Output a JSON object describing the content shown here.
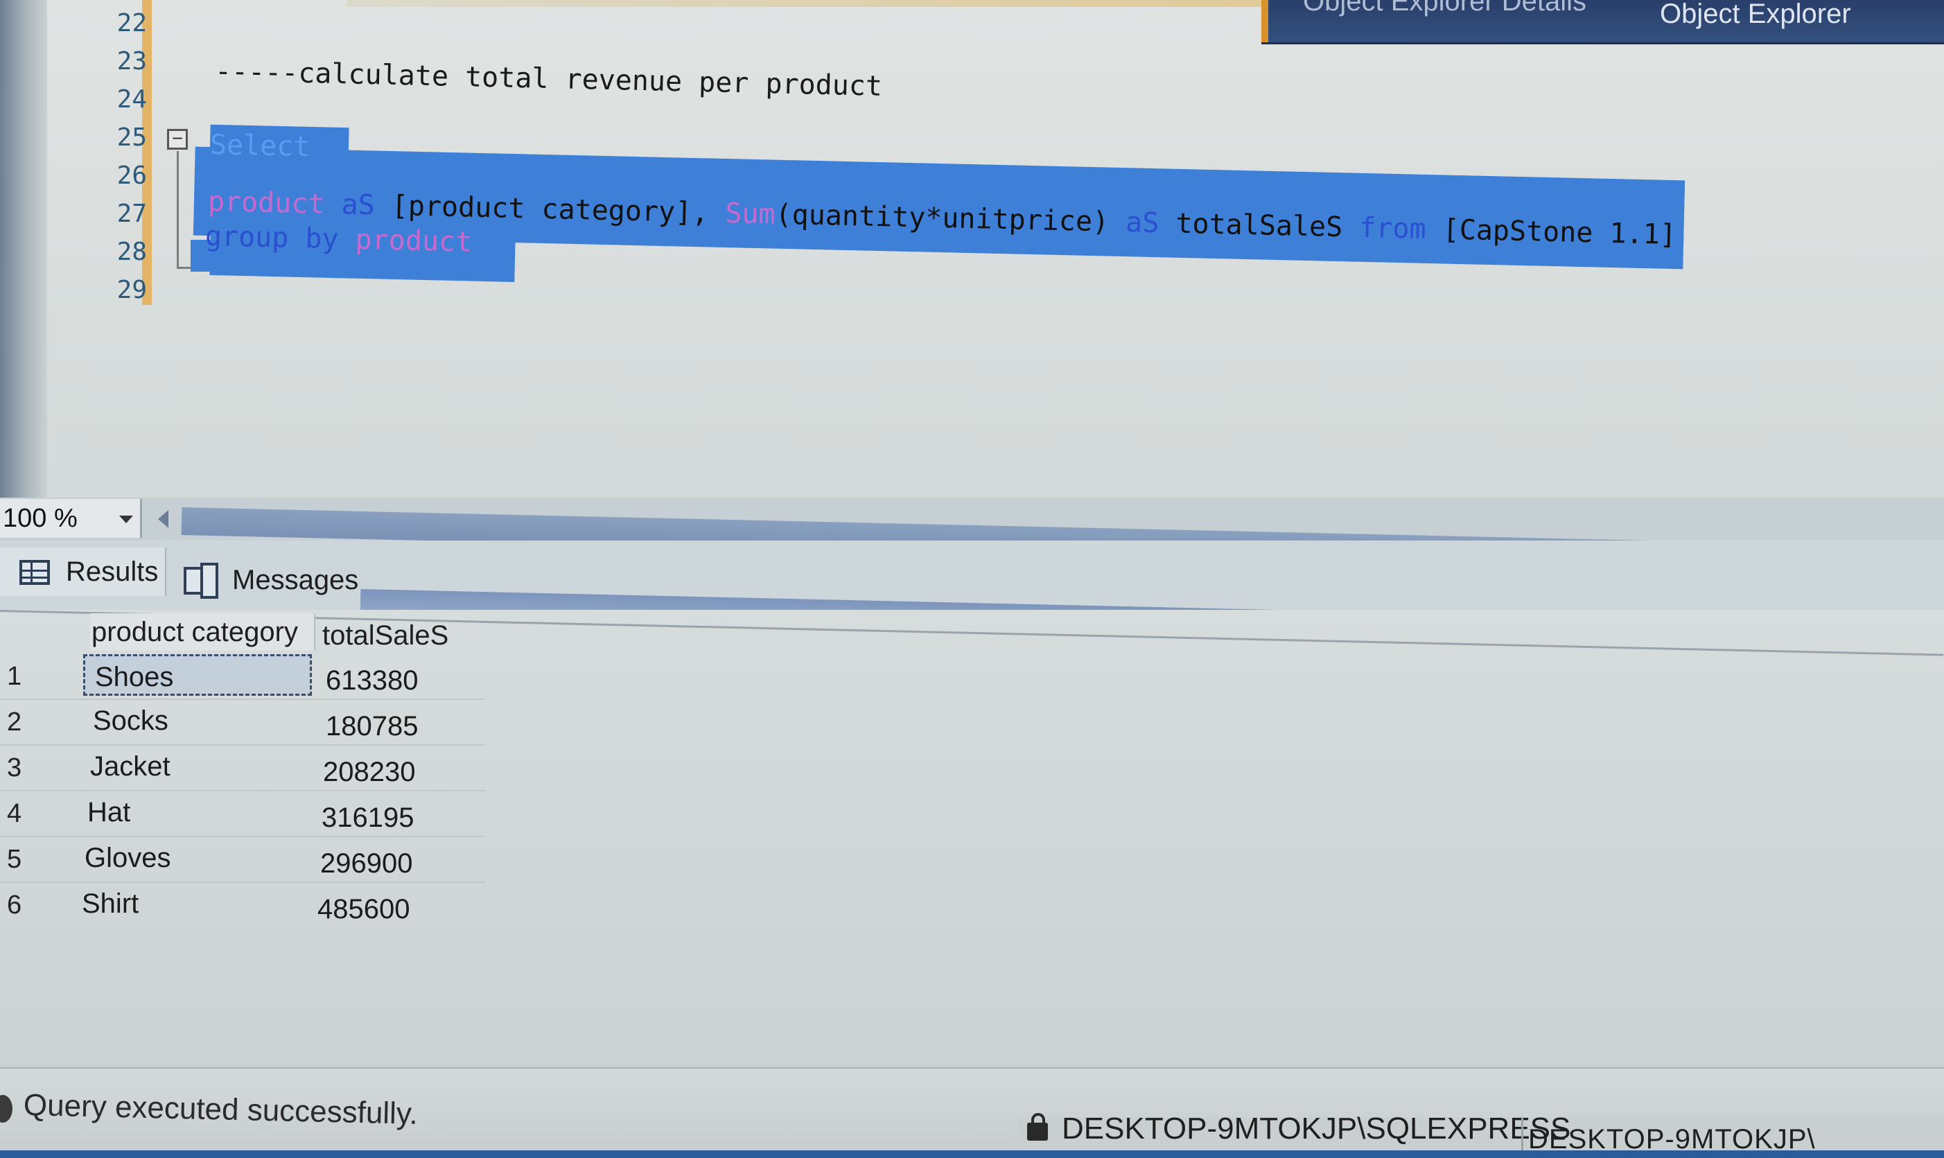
{
  "top_tabs": {
    "tab1": "Object Explorer Details",
    "tab2": "Object Explorer"
  },
  "editor": {
    "line_numbers": [
      "22",
      "23",
      "24",
      "25",
      "26",
      "27",
      "28",
      "29"
    ],
    "comment": "-----calculate total revenue per product",
    "select_kw": "Select",
    "line2": {
      "col": "product",
      "as1": "aS",
      "alias": "[product category],",
      "sum": "Sum",
      "expr": "(quantity*unitprice)",
      "as2": "aS",
      "alias2": "totalSaleS",
      "from": "from",
      "table": "[CapStone 1.1]"
    },
    "line3": {
      "group_by": "group by",
      "col": "product"
    }
  },
  "zoom": {
    "value": "100 %"
  },
  "results_tabs": {
    "results": "Results",
    "messages": "Messages"
  },
  "grid": {
    "headers": [
      "product category",
      "totalSaleS"
    ],
    "rows": [
      {
        "idx": "1",
        "category": "Shoes",
        "total": "613380"
      },
      {
        "idx": "2",
        "category": "Socks",
        "total": "180785"
      },
      {
        "idx": "3",
        "category": "Jacket",
        "total": "208230"
      },
      {
        "idx": "4",
        "category": "Hat",
        "total": "316195"
      },
      {
        "idx": "5",
        "category": "Gloves",
        "total": "296900"
      },
      {
        "idx": "6",
        "category": "Shirt",
        "total": "485600"
      }
    ]
  },
  "status": {
    "message": "Query executed successfully.",
    "server": "DESKTOP-9MTOKJP\\SQLEXPRESS",
    "server2": "DESKTOP-9MTOKJP\\"
  }
}
